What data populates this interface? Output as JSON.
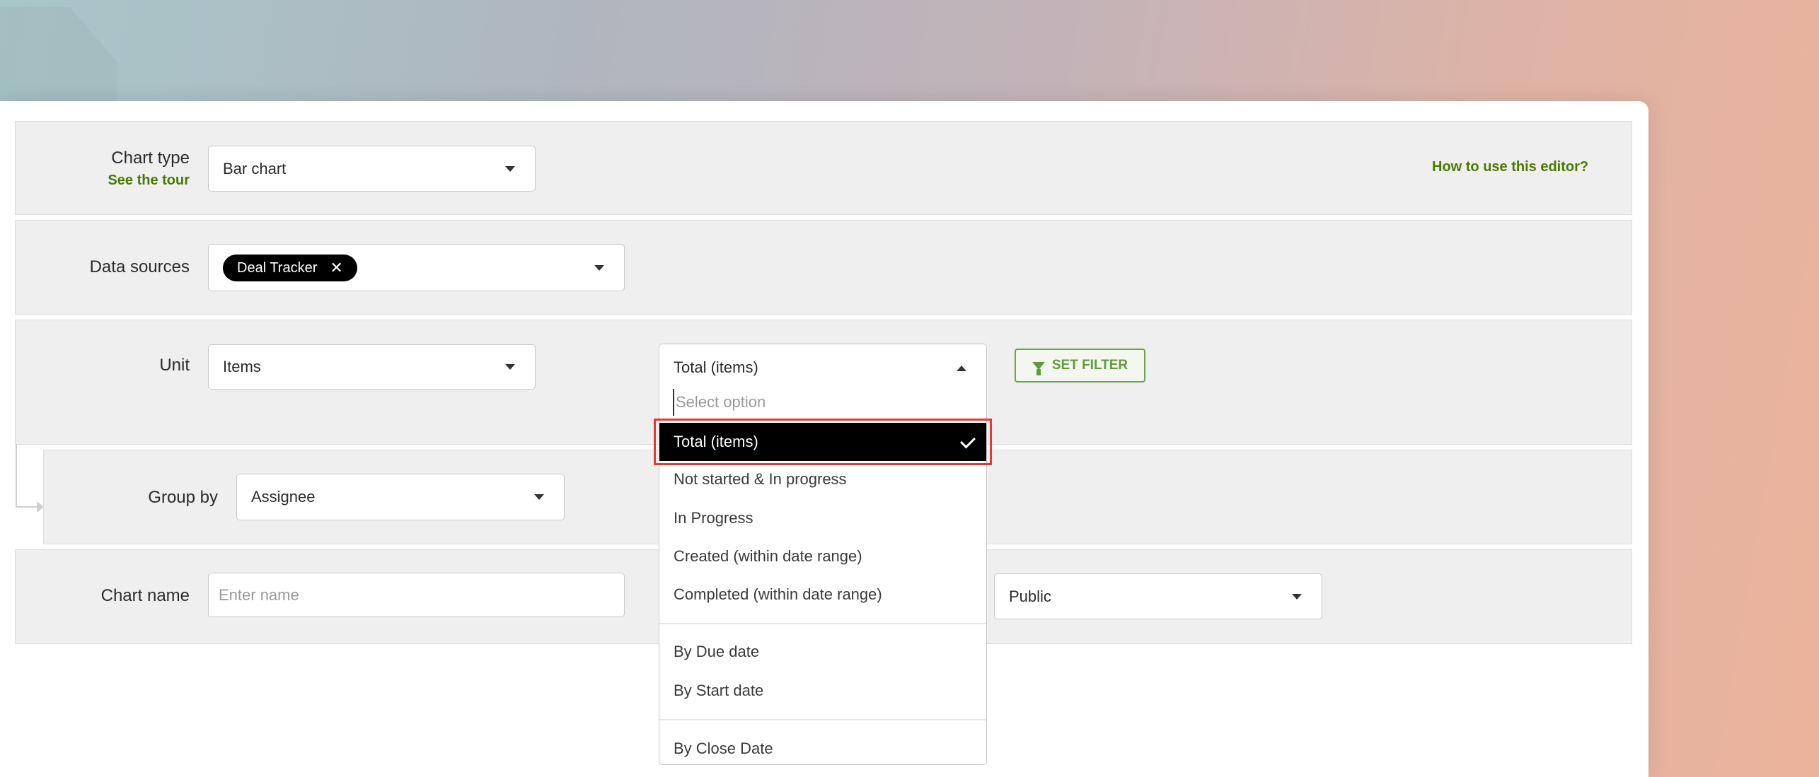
{
  "chart_type": {
    "label": "Chart type",
    "tour_link": "See the tour",
    "value": "Bar chart"
  },
  "help_link": "How to use this editor?",
  "data_sources": {
    "label": "Data sources",
    "chip": "Deal Tracker",
    "chip_remove": "✕"
  },
  "unit": {
    "label": "Unit",
    "value": "Items"
  },
  "measure_dropdown": {
    "value": "Total (items)",
    "search_placeholder": "Select option",
    "options": [
      "Total (items)",
      "Not started & In progress",
      "In Progress",
      "Created (within date range)",
      "Completed (within date range)",
      "By Due date",
      "By Start date",
      "By Close Date"
    ],
    "selected_index": 0
  },
  "filter_button": "SET FILTER",
  "group_by": {
    "label": "Group by",
    "value": "Assignee"
  },
  "chart_name": {
    "label": "Chart name",
    "placeholder": "Enter name"
  },
  "visibility": {
    "value": "Public"
  },
  "colors": {
    "link": "#4a7a00",
    "filter_green": "#5f9b3c",
    "highlight_red": "#e53935"
  }
}
